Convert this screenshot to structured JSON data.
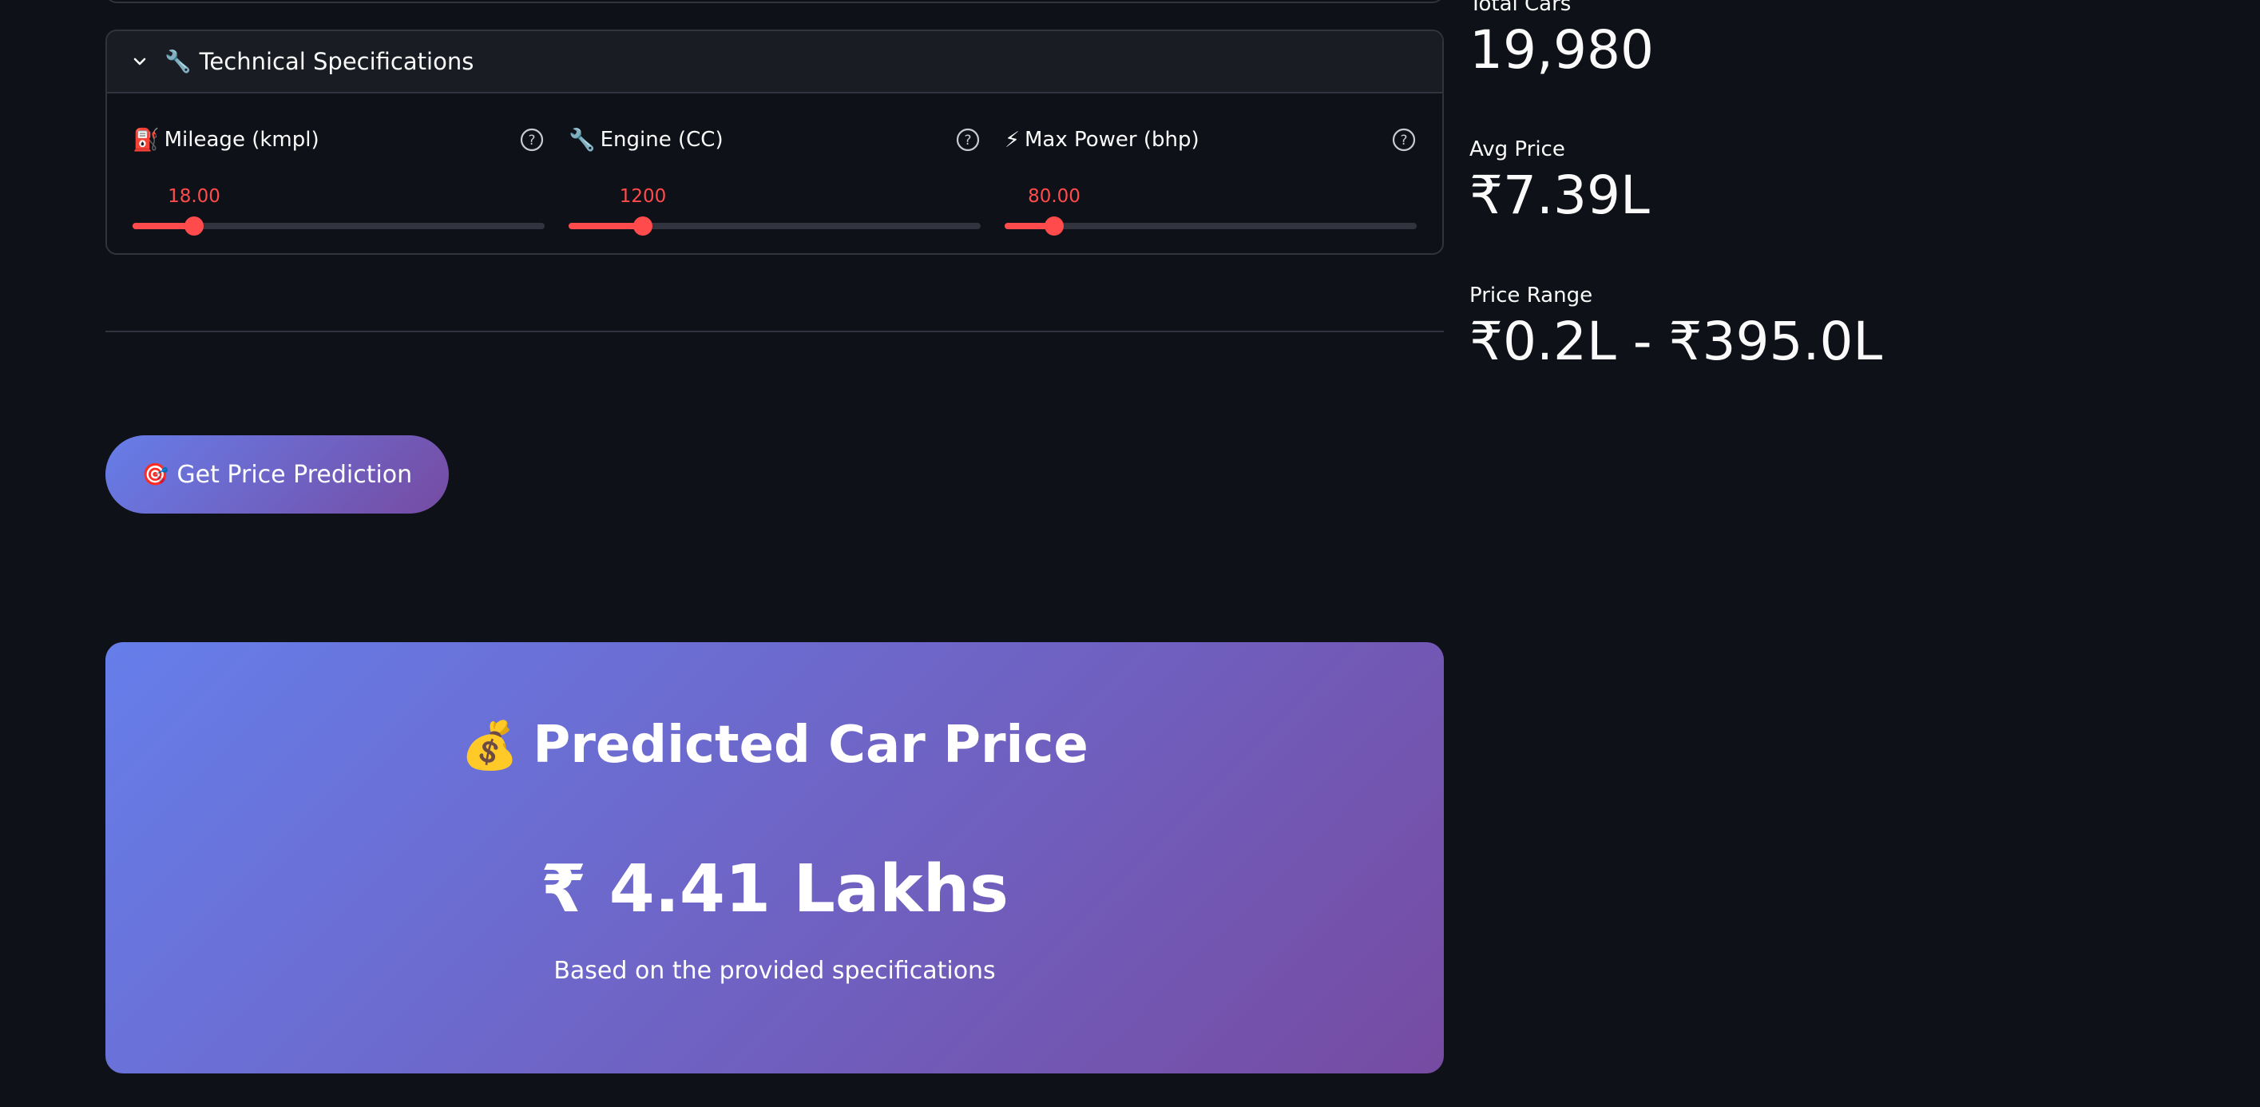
{
  "technical_specs": {
    "title": "Technical Specifications",
    "title_icon": "wrench-icon",
    "sliders": [
      {
        "icon": "fuel-pump-icon",
        "emoji": "⛽",
        "label": "Mileage (kmpl)",
        "value_text": "18.00",
        "fraction": 0.15
      },
      {
        "icon": "wrench-icon",
        "emoji": "🔧",
        "label": "Engine (CC)",
        "value_text": "1200",
        "fraction": 0.18
      },
      {
        "icon": "lightning-icon",
        "emoji": "⚡",
        "label": "Max Power (bhp)",
        "value_text": "80.00",
        "fraction": 0.12
      }
    ]
  },
  "predict_button": {
    "icon": "target-icon",
    "emoji": "🎯",
    "label": "Get Price Prediction"
  },
  "result": {
    "icon": "money-bag-icon",
    "emoji": "💰",
    "title": "Predicted Car Price",
    "price": "₹ 4.41 Lakhs",
    "subtitle": "Based on the provided specifications"
  },
  "metrics": [
    {
      "label": "Total Cars",
      "value": "19,980"
    },
    {
      "label": "Avg Price",
      "value": "₹7.39L"
    },
    {
      "label": "Price Range",
      "value": "₹0.2L - ₹395.0L"
    }
  ],
  "colors": {
    "accent": "#ff4b4b",
    "gradient_start": "#667eea",
    "gradient_end": "#764ba2",
    "background": "#0e1117"
  }
}
